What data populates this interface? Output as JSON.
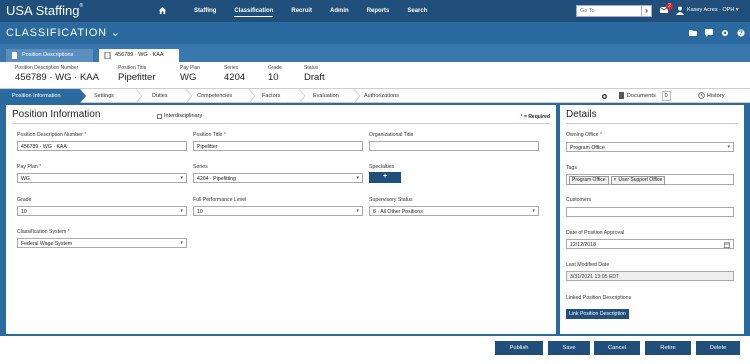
{
  "app": {
    "brand": "USA Staffing",
    "trademark": "®",
    "nav": [
      "Staffing",
      "Classification",
      "Recruit",
      "Admin",
      "Reports",
      "Search"
    ],
    "active_nav": "Classification",
    "goto_placeholder": "Go To",
    "notification_count": "2",
    "user": "Kasey Acres · OPH ▾"
  },
  "subheader": {
    "title": "CLASSIFICATION ⌄"
  },
  "doc_tabs": {
    "inactive": "Position Descriptions",
    "active": "456789 · WG · KAA"
  },
  "info": {
    "pd_number_label": "Position Description Number",
    "pd_number": "456789 · WG · KAA",
    "title_label": "Position Title",
    "title": "Pipefitter",
    "pay_plan_label": "Pay Plan",
    "pay_plan": "WG",
    "series_label": "Series",
    "series": "4204",
    "grade_label": "Grade",
    "grade": "10",
    "status_label": "Status",
    "status": "Draft"
  },
  "steps": [
    "Position Information",
    "Settings",
    "Duties",
    "Competencies",
    "Factors",
    "Evaluation",
    "Authorizations"
  ],
  "tools": {
    "documents": "Documents",
    "documents_count": "0",
    "history": "History"
  },
  "main": {
    "title": "Position Information",
    "interdisciplinary": "Interdisciplinary",
    "required_note": "= Required",
    "fields": {
      "pd_number_label": "Position Description Number",
      "pd_number_value": "456789 · WG · KAA",
      "position_title_label": "Position Title",
      "position_title_value": "Pipefitter",
      "org_title_label": "Organizational Title",
      "org_title_value": "",
      "pay_plan_label": "Pay Plan",
      "pay_plan_value": "WG",
      "series_label": "Series",
      "series_value": "4204 · Pipefitting",
      "specialties_label": "Specialties",
      "specialties_add": "+",
      "grade_label": "Grade",
      "grade_value": "10",
      "full_perf_label": "Full Performance Level",
      "full_perf_value": "10",
      "supervisory_label": "Supervisory Status",
      "supervisory_value": "8 · All Other Positions",
      "class_system_label": "Classification System",
      "class_system_value": "Federal Wage System"
    }
  },
  "details": {
    "title": "Details",
    "owning_office_label": "Owning Office",
    "owning_office_value": "Program Office",
    "tags_label": "Tags",
    "tag1": "Program Office",
    "tag2": "User Support Office",
    "customers_label": "Customers",
    "customers_value": "",
    "approval_date_label": "Date of Position Approval",
    "approval_date_value": "12/12/2018",
    "last_modified_label": "Last Modified Date",
    "last_modified_value": "3/31/2021 13:05 EDT",
    "linked_label": "Linked Position Descriptions",
    "link_button": "Link Position Description"
  },
  "footer": {
    "publish": "Publish",
    "save": "Save",
    "cancel": "Cancel",
    "retire": "Retire",
    "delete": "Delete"
  },
  "colors": {
    "nav_bg": "#1f4f7a",
    "sub_bg": "#2b6a9f",
    "required": "#c0392b",
    "badge": "#d9232d"
  }
}
